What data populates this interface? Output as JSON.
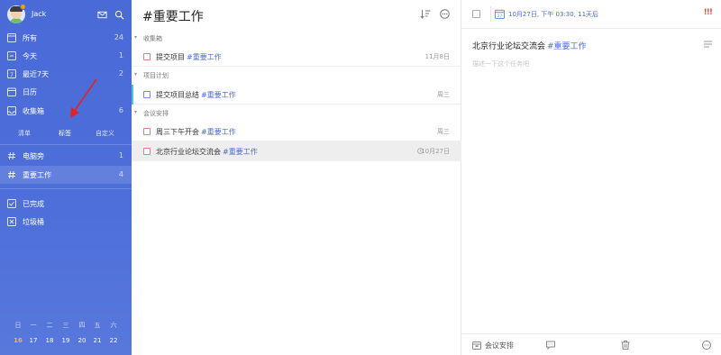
{
  "user": {
    "name": "Jack"
  },
  "sidebar": {
    "smart_lists": [
      {
        "label": "所有",
        "count": "24",
        "icon": "inbox-all-icon"
      },
      {
        "label": "今天",
        "count": "1",
        "icon": "today-icon"
      },
      {
        "label": "最近7天",
        "count": "2",
        "icon": "week-icon"
      },
      {
        "label": "日历",
        "count": "",
        "icon": "calendar-icon"
      },
      {
        "label": "收集箱",
        "count": "6",
        "icon": "inbox-icon"
      }
    ],
    "segments": [
      "清单",
      "标签",
      "自定义"
    ],
    "tags": [
      {
        "label": "电脑旁",
        "count": "1",
        "icon": "hashtag-icon"
      },
      {
        "label": "重要工作",
        "count": "4",
        "icon": "hashtag-icon"
      }
    ],
    "misc": [
      {
        "label": "已完成",
        "icon": "completed-icon"
      },
      {
        "label": "垃圾桶",
        "icon": "trash-icon"
      }
    ],
    "calendar": {
      "weekdays": [
        "日",
        "一",
        "二",
        "三",
        "四",
        "五",
        "六"
      ],
      "days": [
        "16",
        "17",
        "18",
        "19",
        "20",
        "21",
        "22"
      ],
      "today": "16"
    }
  },
  "list": {
    "title": "#重要工作",
    "groups": [
      {
        "label": "收集箱",
        "tasks": [
          {
            "title": "提交项目",
            "tag": "#重要工作",
            "date": "11月8日",
            "checkbox": "red"
          }
        ]
      },
      {
        "label": "项目计划",
        "tasks": [
          {
            "title": "提交项目总结",
            "tag": "#重要工作",
            "date": "周三",
            "checkbox": "blue"
          }
        ]
      },
      {
        "label": "会议安排",
        "tasks": [
          {
            "title": "周三下午开会",
            "tag": "#重要工作",
            "date": "周三",
            "checkbox": "red"
          },
          {
            "title": "北京行业论坛交流会",
            "tag": "#重要工作",
            "date": "10月27日",
            "checkbox": "red"
          }
        ]
      }
    ]
  },
  "detail": {
    "date_text": "10月27日, 下午 03:30, 11天后",
    "priority": "!!!",
    "title": "北京行业论坛交流会",
    "tag": "#重要工作",
    "description_placeholder": "描述一下这个任务吧",
    "list_name": "会议安排"
  },
  "colors": {
    "sidebar": "#4a6ad8",
    "accent": "#4a6ad8",
    "priority_high": "#e05252",
    "today": "#f5b83d",
    "project_marker": "#4ec5c9"
  }
}
